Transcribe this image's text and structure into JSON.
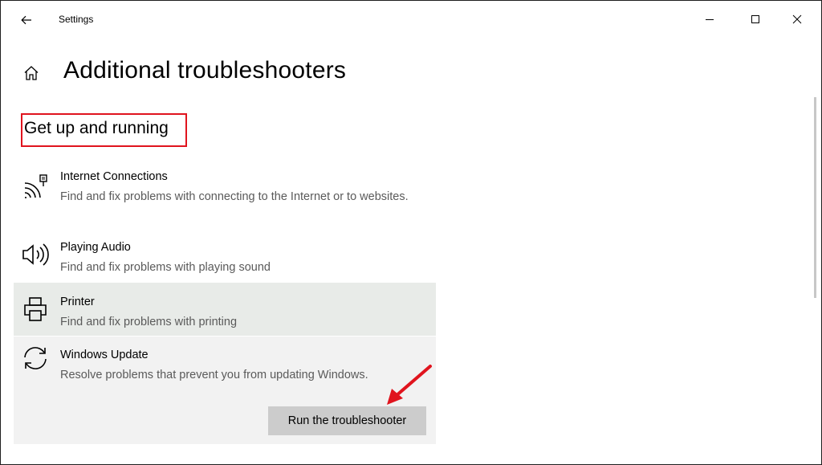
{
  "window": {
    "app_title": "Settings",
    "back_icon": "arrow-left-icon",
    "controls": {
      "minimize_icon": "minimize-icon",
      "maximize_icon": "maximize-icon",
      "close_icon": "close-icon"
    }
  },
  "header": {
    "home_icon": "home-icon",
    "title": "Additional troubleshooters"
  },
  "section": {
    "heading": "Get up and running",
    "highlight_color": "#e0141e"
  },
  "items": [
    {
      "title": "Internet Connections",
      "description": "Find and fix problems with connecting to the Internet or to websites.",
      "icon": "network-icon"
    },
    {
      "title": "Playing Audio",
      "description": "Find and fix problems with playing sound",
      "icon": "speaker-icon"
    },
    {
      "title": "Printer",
      "description": "Find and fix problems with printing",
      "icon": "printer-icon"
    },
    {
      "title": "Windows Update",
      "description": "Resolve problems that prevent you from updating Windows.",
      "icon": "sync-icon"
    }
  ],
  "run_button_label": "Run the troubleshooter",
  "colors": {
    "selected_item_bg": "#f2f2f2",
    "hover_item_bg": "#e8ebe8",
    "button_bg": "#cccccc",
    "annotation_arrow": "#e0141e"
  }
}
